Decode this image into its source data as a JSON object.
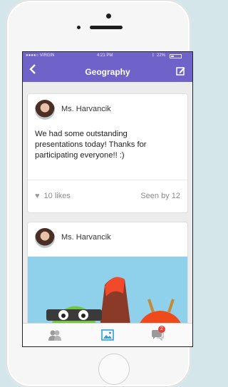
{
  "status_bar": {
    "carrier": "●●●●○ VIRGIN",
    "time": "4:21 PM",
    "battery": "22%"
  },
  "nav": {
    "title": "Geography",
    "back_icon": "chevron-left-icon",
    "edit_icon": "compose-icon",
    "bg_color": "#6f62c8"
  },
  "posts": [
    {
      "author": "Ms. Harvancik",
      "text": "We had some outstanding presentations today! Thanks for participating everyone!! :)",
      "likes": "10 likes",
      "seen": "Seen by 12"
    },
    {
      "author": "Ms. Harvancik"
    }
  ],
  "tabbar": {
    "items": [
      {
        "icon": "people-icon"
      },
      {
        "icon": "photos-icon"
      },
      {
        "icon": "messages-icon",
        "badge": "2"
      }
    ]
  }
}
